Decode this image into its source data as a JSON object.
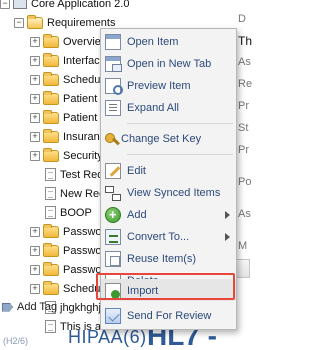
{
  "tree": {
    "root_label": "Core Application 2.0",
    "requirements_label": "Requirements",
    "children": [
      {
        "label": "Overview",
        "type": "folder"
      },
      {
        "label": "Interface",
        "type": "folder"
      },
      {
        "label": "Schedulin",
        "type": "folder"
      },
      {
        "label": "Patient In",
        "type": "folder"
      },
      {
        "label": "Patient D",
        "type": "folder"
      },
      {
        "label": "Insuranc",
        "type": "folder"
      },
      {
        "label": "Security",
        "type": "folder"
      },
      {
        "label": "Test Req",
        "type": "doc"
      },
      {
        "label": "New Req",
        "type": "doc"
      },
      {
        "label": "BOOP",
        "type": "doc"
      },
      {
        "label": "Passwor",
        "type": "folder"
      },
      {
        "label": "Passwor",
        "type": "folder"
      },
      {
        "label": "Passwor",
        "type": "folder"
      },
      {
        "label": "Schedulin",
        "type": "folder"
      },
      {
        "label": "jhgkhghj",
        "type": "doc"
      },
      {
        "label": "This is a",
        "type": "doc"
      }
    ]
  },
  "right_panel": {
    "fragments": [
      "D",
      "Th",
      "As",
      "Re",
      "Pr",
      "St",
      "Pr",
      "Po",
      "As",
      "M"
    ],
    "tab_label": "omm"
  },
  "context_menu": {
    "items": [
      {
        "label": "Open Item",
        "icon": "open-item-icon",
        "submenu": false
      },
      {
        "label": "Open in New Tab",
        "icon": "new-tab-icon",
        "submenu": false
      },
      {
        "label": "Preview Item",
        "icon": "preview-icon",
        "submenu": false
      },
      {
        "label": "Expand All",
        "icon": "expand-all-icon",
        "submenu": false
      },
      {
        "label": "Change Set Key",
        "icon": "key-icon",
        "submenu": false
      },
      {
        "label": "Edit",
        "icon": "edit-icon",
        "submenu": false
      },
      {
        "label": "View Synced Items",
        "icon": "synced-items-icon",
        "submenu": false
      },
      {
        "label": "Add",
        "icon": "add-icon",
        "submenu": true
      },
      {
        "label": "Convert To...",
        "icon": "convert-icon",
        "submenu": true
      },
      {
        "label": "Reuse Item(s)",
        "icon": "reuse-icon",
        "submenu": false
      },
      {
        "label": "Delete",
        "icon": "delete-icon",
        "submenu": false
      },
      {
        "label": "Import",
        "icon": "import-icon",
        "submenu": false
      },
      {
        "label": "Send For Review",
        "icon": "send-review-icon",
        "submenu": false
      }
    ],
    "highlighted_item": "Import",
    "highlight_color": "#e8463a"
  },
  "bottom": {
    "add_tag_label": "Add Tag",
    "tags": {
      "small": "(H2/6)",
      "hipaa": "HIPAA(6)",
      "hl7": "HL7 -"
    }
  },
  "colors": {
    "menu_text": "#2c4a7a",
    "tag_text": "#2e5a97",
    "folder": "#f0b83c"
  }
}
